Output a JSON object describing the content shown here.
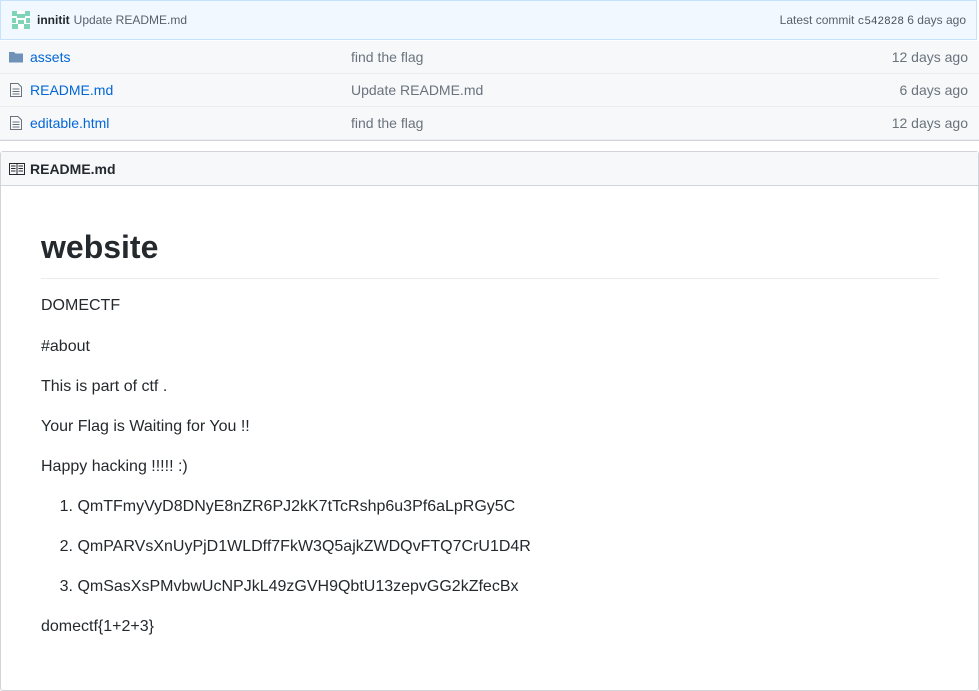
{
  "commit": {
    "author": "innitit",
    "message": "Update README.md",
    "latest_label": "Latest commit",
    "sha": "c542828",
    "age": "6 days ago"
  },
  "files": [
    {
      "name": "assets",
      "type": "folder",
      "message": "find the flag",
      "age": "12 days ago"
    },
    {
      "name": "README.md",
      "type": "file",
      "message": "Update README.md",
      "age": "6 days ago"
    },
    {
      "name": "editable.html",
      "type": "file",
      "message": "find the flag",
      "age": "12 days ago"
    }
  ],
  "readme": {
    "filename": "README.md",
    "title": "website",
    "paragraphs_top": [
      "DOMECTF",
      "#about",
      "This is part of ctf .",
      "Your Flag is Waiting for You !!",
      "Happy hacking !!!!! :)"
    ],
    "list": [
      {
        "num": "1.",
        "text": "QmTFmyVyD8DNyE8nZR6PJ2kK7tTcRshp6u3Pf6aLpRGy5C"
      },
      {
        "num": "2.",
        "text": "QmPARVsXnUyPjD1WLDff7FkW3Q5ajkZWDQvFTQ7CrU1D4R"
      },
      {
        "num": "3.",
        "text": "QmSasXsPMvbwUcNPJkL49zGVH9QbtU13zepvGG2kZfecBx"
      }
    ],
    "footer": "domectf{1+2+3}"
  },
  "icons": {
    "folder": "folder-icon",
    "file": "file-icon",
    "readme": "book-icon",
    "avatar": "identicon"
  },
  "colors": {
    "link": "#0366d6",
    "commit_bar_bg": "#f1f8ff",
    "folder_icon": "#79b8ff"
  }
}
